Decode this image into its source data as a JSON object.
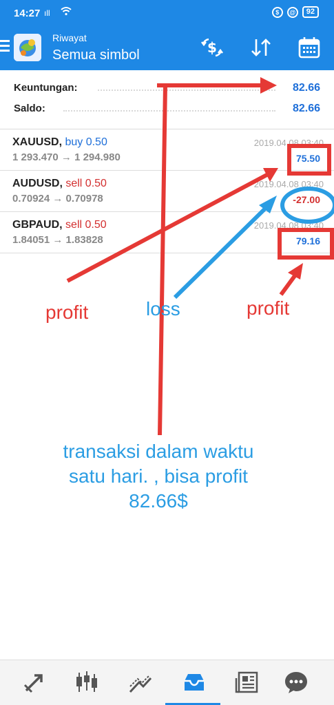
{
  "status": {
    "time": "14:27",
    "signal": "ᴴ ıll",
    "battery": "92"
  },
  "header": {
    "subtitle": "Riwayat",
    "title": "Semua simbol"
  },
  "summary": {
    "profit_label": "Keuntungan:",
    "profit_value": "82.66",
    "balance_label": "Saldo:",
    "balance_value": "82.66"
  },
  "trades": [
    {
      "symbol": "XAUUSD,",
      "side": "buy 0.50",
      "prices": "1 293.470 → 1 294.980",
      "date": "2019.04.08 03:40",
      "profit": "75.50"
    },
    {
      "symbol": "AUDUSD,",
      "side": "sell 0.50",
      "prices": "0.70924 → 0.70978",
      "date": "2019.04.08 03:40",
      "profit": "-27.00"
    },
    {
      "symbol": "GBPAUD,",
      "side": "sell 0.50",
      "prices": "1.84051 → 1.83828",
      "date": "2019.04.08 03:40",
      "profit": "79.16"
    }
  ],
  "annotations": {
    "profit_left": "profit",
    "loss": "loss",
    "profit_right": "profit",
    "note_line1": "transaksi dalam waktu",
    "note_line2": "satu hari. , bisa profit",
    "note_line3": "82.66$"
  },
  "colors": {
    "accent": "#1e88e5",
    "profit": "#1e6fd9",
    "loss": "#d32f2f",
    "annotation_red": "#e53935",
    "annotation_blue": "#2b9de3"
  },
  "icons": {
    "toolbar": [
      "exchange-dollar-icon",
      "sort-icon",
      "calendar-icon"
    ],
    "nav": [
      "quotes-icon",
      "chart-candles-icon",
      "trade-icon",
      "history-icon",
      "news-icon",
      "chat-icon"
    ]
  }
}
